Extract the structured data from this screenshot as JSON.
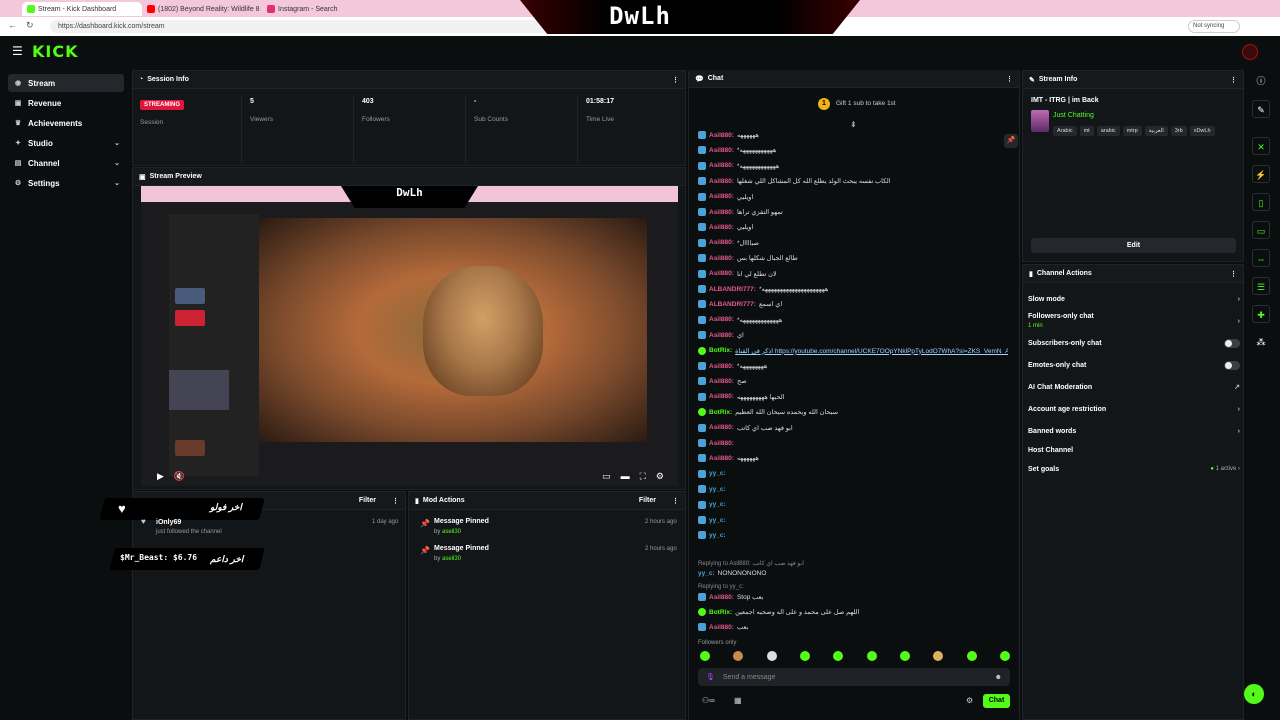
{
  "browser": {
    "tabs": [
      {
        "label": "Stream - Kick Dashboard",
        "color": "#53fc18"
      },
      {
        "label": "(1802) Beyond Reality: Wildlife 8",
        "color": "#ff0000"
      },
      {
        "label": "Instagram - Search",
        "color": "#e1306c"
      }
    ],
    "url": "https://dashboard.kick.com/stream",
    "sync_label": "Not syncing",
    "overlay_title": "DwLh"
  },
  "nav": {
    "logo": "KICK"
  },
  "sidebar": {
    "items": [
      {
        "label": "Stream",
        "icon": "stream-icon"
      },
      {
        "label": "Revenue",
        "icon": "revenue-icon"
      },
      {
        "label": "Achievements",
        "icon": "trophy-icon"
      },
      {
        "label": "Studio",
        "icon": "studio-icon"
      },
      {
        "label": "Channel",
        "icon": "channel-icon"
      },
      {
        "label": "Settings",
        "icon": "gear-icon"
      }
    ]
  },
  "session_info": {
    "title": "Session Info",
    "badge": "STREAMING",
    "stats": [
      {
        "value": "",
        "label": "Session"
      },
      {
        "value": "5",
        "label": "Viewers"
      },
      {
        "value": "403",
        "label": "Followers"
      },
      {
        "value": "-",
        "label": "Sub Counts"
      },
      {
        "value": "01:58:17",
        "label": "Time Live"
      }
    ]
  },
  "stream_preview": {
    "title": "Stream Preview",
    "overlay_title": "DwLh"
  },
  "activity": {
    "filter_label": "Filter",
    "overlay_follow": "اخر فولو",
    "overlay_donation": "اخر داعم",
    "donation_text": "$Mr_Beast: $6.76",
    "follower_name": "iOnly69",
    "follower_action": "just followed the channel",
    "follower_time": "1 day ago"
  },
  "mod_actions": {
    "title": "Mod Actions",
    "filter_label": "Filter",
    "items": [
      {
        "action": "Message Pinned",
        "by_prefix": "by",
        "by": "aseil30",
        "time": "2 hours ago"
      },
      {
        "action": "Message Pinned",
        "by_prefix": "by",
        "by": "aseil30",
        "time": "2 hours ago"
      }
    ]
  },
  "chat": {
    "title": "Chat",
    "gift_banner": "Gift 1 sub to take 1st",
    "gift_count": "1",
    "messages": [
      {
        "user": "Asil880",
        "text": "ههههههه",
        "color": "#e45b8a"
      },
      {
        "user": "Asil880",
        "text": "*هههههههههههه",
        "color": "#e45b8a"
      },
      {
        "user": "Asil880",
        "text": "*ههههههههههههه",
        "color": "#e45b8a"
      },
      {
        "user": "Asil880",
        "text": "الكاب نفسه يبحث الولد يطلع الله كل المشاكل اللي شغلها",
        "color": "#e45b8a"
      },
      {
        "user": "Asil880",
        "text": "اويليي",
        "color": "#e45b8a"
      },
      {
        "user": "Asil880",
        "text": "تمهو التقزي تراها",
        "color": "#e45b8a"
      },
      {
        "user": "Asil880",
        "text": "اويليي",
        "color": "#e45b8a"
      },
      {
        "user": "Asil880",
        "text": "*صباااال",
        "color": "#e45b8a"
      },
      {
        "user": "Asil880",
        "text": "طالع الجبال شكلها بس",
        "color": "#e45b8a"
      },
      {
        "user": "Asil880",
        "text": "لان تطلع لي انا",
        "color": "#e45b8a"
      },
      {
        "user": "ALBANDRI777",
        "text": "*هههههههههههههههههههههه",
        "color": "#e45b8a"
      },
      {
        "user": "ALBANDRI777",
        "text": "اي اسمع",
        "color": "#e45b8a"
      },
      {
        "user": "Asil880",
        "text": "*هههههههههههههه",
        "color": "#e45b8a"
      },
      {
        "user": "Asil880",
        "text": "اي",
        "color": "#e45b8a"
      },
      {
        "user": "BotRix",
        "text": "اذكر في القناة https://youtube.com/channel/UCKE7OOpYNklPpTyLodO7WhA?si=ZKS_VemN_AgIrEv8",
        "color": "#53fc18",
        "bot": true
      },
      {
        "user": "Asil880",
        "text": "*ههههههههه",
        "color": "#e45b8a"
      },
      {
        "user": "Asil880",
        "text": "صح",
        "color": "#e45b8a"
      },
      {
        "user": "Asil880",
        "text": "الحبها هههههههههه",
        "color": "#e45b8a"
      },
      {
        "user": "BotRix",
        "text": "سبحان الله وبحمده سبحان الله العظيم",
        "color": "#53fc18",
        "bot": true
      },
      {
        "user": "Asil880",
        "text": "ابو فهد صب اي كاتب",
        "color": "#e45b8a"
      },
      {
        "user": "Asil880",
        "text": "",
        "color": "#e45b8a"
      },
      {
        "user": "Asil880",
        "text": "ههههههه",
        "color": "#e45b8a"
      },
      {
        "user": "yy_c",
        "text": "",
        "color": "#4aa3d6"
      },
      {
        "user": "yy_c",
        "text": "",
        "color": "#4aa3d6"
      },
      {
        "user": "yy_c",
        "text": "",
        "color": "#4aa3d6"
      },
      {
        "user": "yy_c",
        "text": "",
        "color": "#4aa3d6"
      },
      {
        "user": "yy_c",
        "text": "",
        "color": "#4aa3d6"
      }
    ],
    "reply_1": "Replying to Asil880: ابو فهد صب اي كاتب",
    "reply_1_user": "yy_c",
    "reply_1_text": "NONONONONO",
    "reply_2": "Replying to yy_c:",
    "after_reply": [
      {
        "user": "Asil880",
        "text": "Stop بعب",
        "color": "#e45b8a"
      },
      {
        "user": "BotRix",
        "text": "اللهم صل على محمد و على اله وصحبه اجمعين",
        "color": "#53fc18",
        "bot": true
      },
      {
        "user": "Asil880",
        "text": "بعب",
        "color": "#e45b8a"
      }
    ],
    "followers_only": "Followers only",
    "input_placeholder": "Send a message",
    "send_label": "Chat"
  },
  "stream_info": {
    "title": "Stream Info",
    "stream_title": "IMT - ITRG | im Back",
    "category": "Just Chatting",
    "tags": [
      "Arabic",
      "mt",
      "arabic",
      "mtrp",
      "العربية",
      "3rb",
      "xDwLh"
    ],
    "edit_label": "Edit"
  },
  "channel_actions": {
    "title": "Channel Actions",
    "items": [
      {
        "label": "Slow mode",
        "type": "chevron"
      },
      {
        "label": "Followers-only chat",
        "sub": "1 min",
        "type": "chevron"
      },
      {
        "label": "Subscribers-only chat",
        "type": "toggle"
      },
      {
        "label": "Emotes-only chat",
        "type": "toggle"
      },
      {
        "label": "AI Chat Moderation",
        "type": "link"
      },
      {
        "label": "Account age restriction",
        "type": "chevron"
      },
      {
        "label": "Banned words",
        "type": "chevron"
      },
      {
        "label": "Host Channel",
        "type": "none"
      },
      {
        "label": "Set goals",
        "sub_right": "1 active",
        "type": "chevron"
      }
    ]
  },
  "colors": {
    "brand": "#53fc18",
    "live": "#e0153c"
  }
}
